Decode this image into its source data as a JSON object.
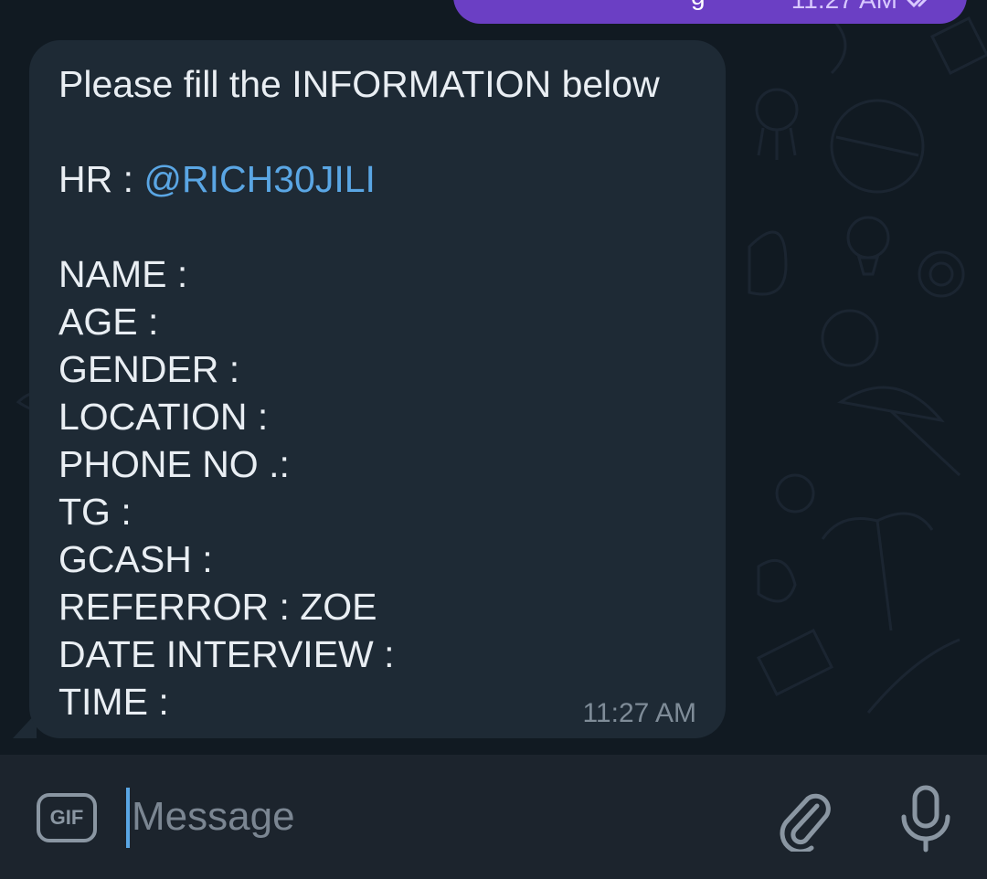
{
  "outgoing_message": {
    "partial_text": "g",
    "time": "11:27 AM",
    "status_icon": "double-check-icon"
  },
  "incoming_message": {
    "intro": "Please fill the INFORMATION below",
    "hr_label": "HR : ",
    "hr_mention": "@RICH30JILI",
    "fields": [
      "NAME :",
      "AGE :",
      "GENDER :",
      "LOCATION :",
      "PHONE NO .:",
      "TG :",
      "GCASH :",
      "REFERROR : ZOE",
      "DATE INTERVIEW :",
      "TIME :"
    ],
    "time": "11:27 AM"
  },
  "composer": {
    "gif_label": "GIF",
    "placeholder": "Message",
    "value": "",
    "attach_icon": "paperclip-icon",
    "mic_icon": "microphone-icon"
  },
  "colors": {
    "background": "#111a22",
    "incoming_bubble": "#1e2a35",
    "outgoing_bubble": "#6b3fc4",
    "mention": "#5aa6e4",
    "composer": "#1c242d"
  }
}
